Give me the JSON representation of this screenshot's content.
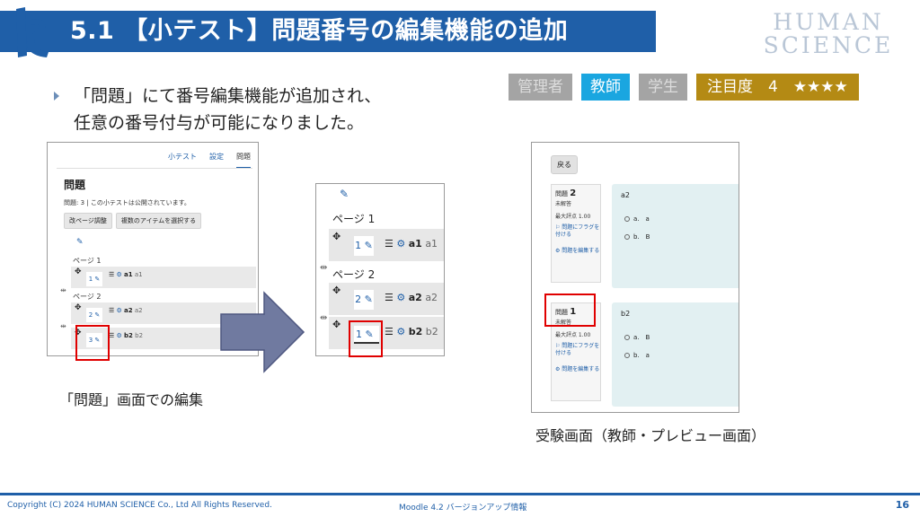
{
  "header": {
    "title": "5.1 【小テスト】問題番号の編集機能の追加",
    "brand_line1": "HUMAN",
    "brand_line2": "SCIENCE"
  },
  "badges": {
    "admin": "管理者",
    "teacher": "教師",
    "student": "学生",
    "attention": "注目度　4　★★★★"
  },
  "intro": {
    "line1": "「問題」にて番号編集機能が追加され、",
    "line2": "任意の番号付与が可能になりました。"
  },
  "panel_questions": {
    "tabs": [
      "小テスト",
      "設定",
      "問題"
    ],
    "heading": "問題",
    "status": "問題: 3 | この小テストは公開されています。",
    "btn_repaginate": "改ページ調整",
    "btn_select": "複数のアイテムを選択する",
    "page1": "ページ 1",
    "page2": "ページ 2",
    "rows": [
      {
        "num": "1",
        "name": "a1",
        "sub": "a1"
      },
      {
        "num": "2",
        "name": "a2",
        "sub": "a2"
      },
      {
        "num": "3",
        "name": "b2",
        "sub": "b2"
      }
    ]
  },
  "panel_zoom": {
    "page1": "ページ 1",
    "page2": "ページ 2",
    "rows": [
      {
        "num": "1",
        "name": "a1",
        "sub": "a1"
      },
      {
        "num": "2",
        "name": "a2",
        "sub": "a2"
      },
      {
        "num": "",
        "name": "b2",
        "sub": "b2"
      }
    ],
    "edit_value": "1"
  },
  "caption_left": "「問題」画面での編集",
  "panel_preview": {
    "back": "戻る",
    "questions": [
      {
        "label": "問題",
        "no": "2",
        "state": "未解答",
        "max": "最大評点 1.00",
        "flag": "問題にフラグを付ける",
        "edit": "問題を編集する",
        "text": "a2",
        "opts": [
          "a.　a",
          "b.　B"
        ]
      },
      {
        "label": "問題",
        "no": "1",
        "state": "未解答",
        "max": "最大評点 1.00",
        "flag": "問題にフラグを付ける",
        "edit": "問題を編集する",
        "text": "b2",
        "opts": [
          "a.　B",
          "b.　a"
        ]
      }
    ]
  },
  "caption_right": "受験画面（教師・プレビュー画面）",
  "footer": {
    "copyright": "Copyright (C) 2024 HUMAN SCIENCE Co., Ltd All Rights Reserved.",
    "center": "Moodle 4.2 バージョンアップ情報",
    "page": "16"
  },
  "colors": {
    "primary": "#1f5fa8",
    "highlight": "#e00000",
    "badge_teacher": "#1aa6e0",
    "badge_attention": "#b48a14",
    "badge_inactive": "#a4a4a4"
  }
}
